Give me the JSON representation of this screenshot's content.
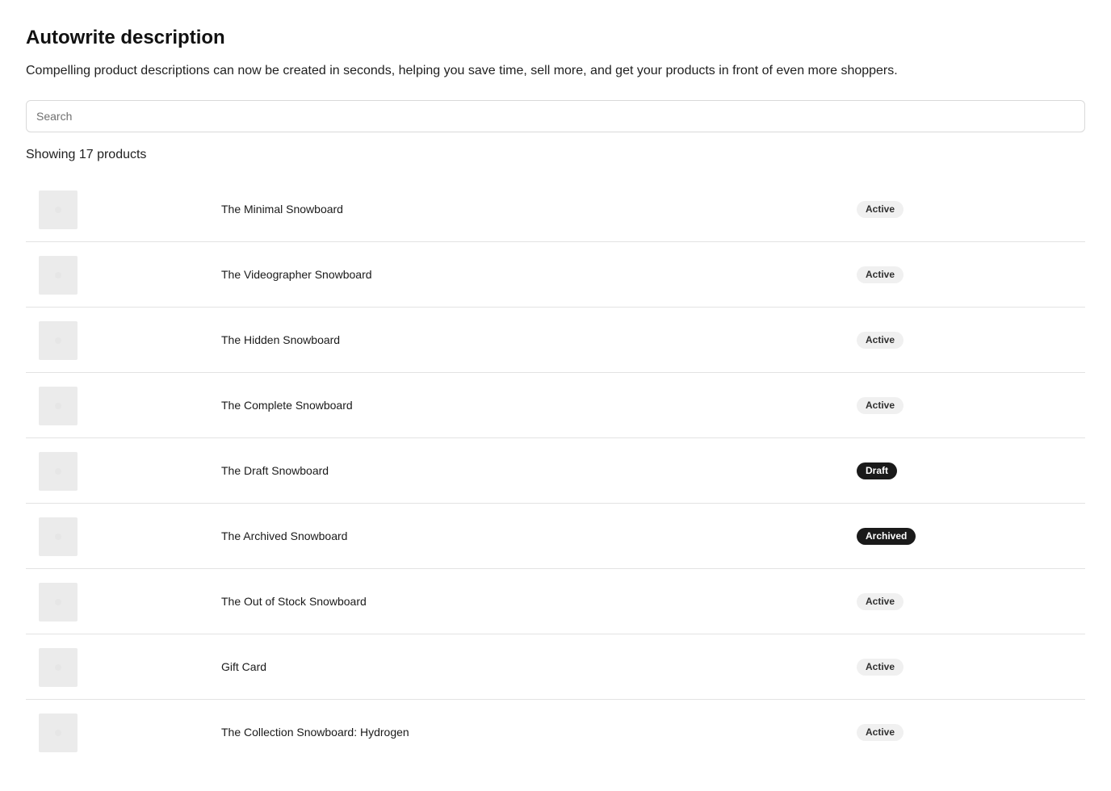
{
  "page": {
    "title": "Autowrite description",
    "subtitle": "Compelling product descriptions can now be created in seconds, helping you save time, sell more, and get your products in front of even more shoppers."
  },
  "search": {
    "placeholder": "Search",
    "value": ""
  },
  "results": {
    "count_text": "Showing 17 products"
  },
  "products": [
    {
      "name": "The Minimal Snowboard",
      "status": "Active"
    },
    {
      "name": "The Videographer Snowboard",
      "status": "Active"
    },
    {
      "name": "The Hidden Snowboard",
      "status": "Active"
    },
    {
      "name": "The Complete Snowboard",
      "status": "Active"
    },
    {
      "name": "The Draft Snowboard",
      "status": "Draft"
    },
    {
      "name": "The Archived Snowboard",
      "status": "Archived"
    },
    {
      "name": "The Out of Stock Snowboard",
      "status": "Active"
    },
    {
      "name": "Gift Card",
      "status": "Active"
    },
    {
      "name": "The Collection Snowboard: Hydrogen",
      "status": "Active"
    }
  ],
  "colors": {
    "badge_active_bg": "#f0f0f0",
    "badge_dark_bg": "#1a1a1a",
    "thumbnail_bg": "#ebebeb"
  }
}
